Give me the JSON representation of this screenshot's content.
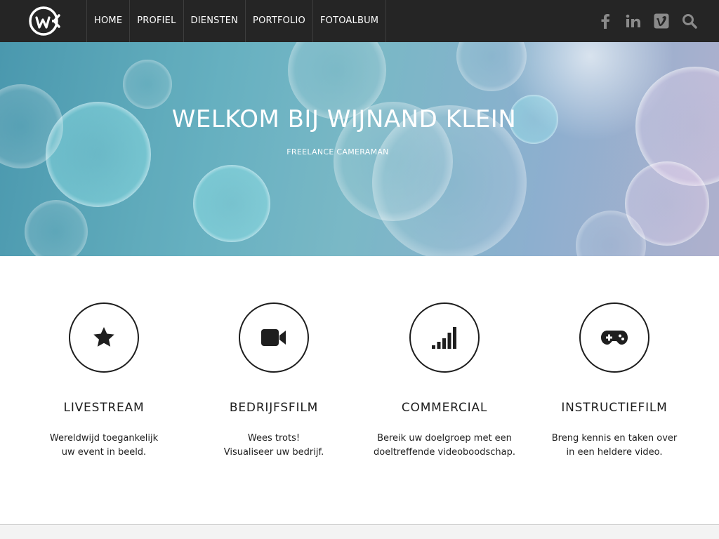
{
  "header": {
    "logo_icon": "wk-logo-icon",
    "nav": [
      {
        "label": "HOME"
      },
      {
        "label": "PROFIEL"
      },
      {
        "label": "DIENSTEN"
      },
      {
        "label": "PORTFOLIO"
      },
      {
        "label": "FOTOALBUM"
      }
    ],
    "social_icons": [
      "facebook-icon",
      "linkedin-icon",
      "vimeo-icon",
      "search-icon"
    ]
  },
  "hero": {
    "title": "WELKOM BIJ WIJNAND KLEIN",
    "subtitle": "FREELANCE CAMERAMAN"
  },
  "services": [
    {
      "icon": "star-icon",
      "title": "LIVESTREAM",
      "line1": "Wereldwijd toegankelijk",
      "line2": "uw event in beeld."
    },
    {
      "icon": "video-camera-icon",
      "title": "BEDRIJFSFILM",
      "line1": "Wees trots!",
      "line2": "Visualiseer uw bedrijf."
    },
    {
      "icon": "signal-bars-icon",
      "title": "COMMERCIAL",
      "line1": "Bereik uw doelgroep met een",
      "line2": "doeltreffende videoboodschap."
    },
    {
      "icon": "gamepad-icon",
      "title": "INSTRUCTIEFILM",
      "line1": "Breng kennis en taken over",
      "line2": "in een heldere video."
    }
  ],
  "colors": {
    "topbar": "#252525",
    "text": "#1e1e1e",
    "hero_start": "#4e9fb6",
    "hero_end": "#b7b8d6"
  }
}
